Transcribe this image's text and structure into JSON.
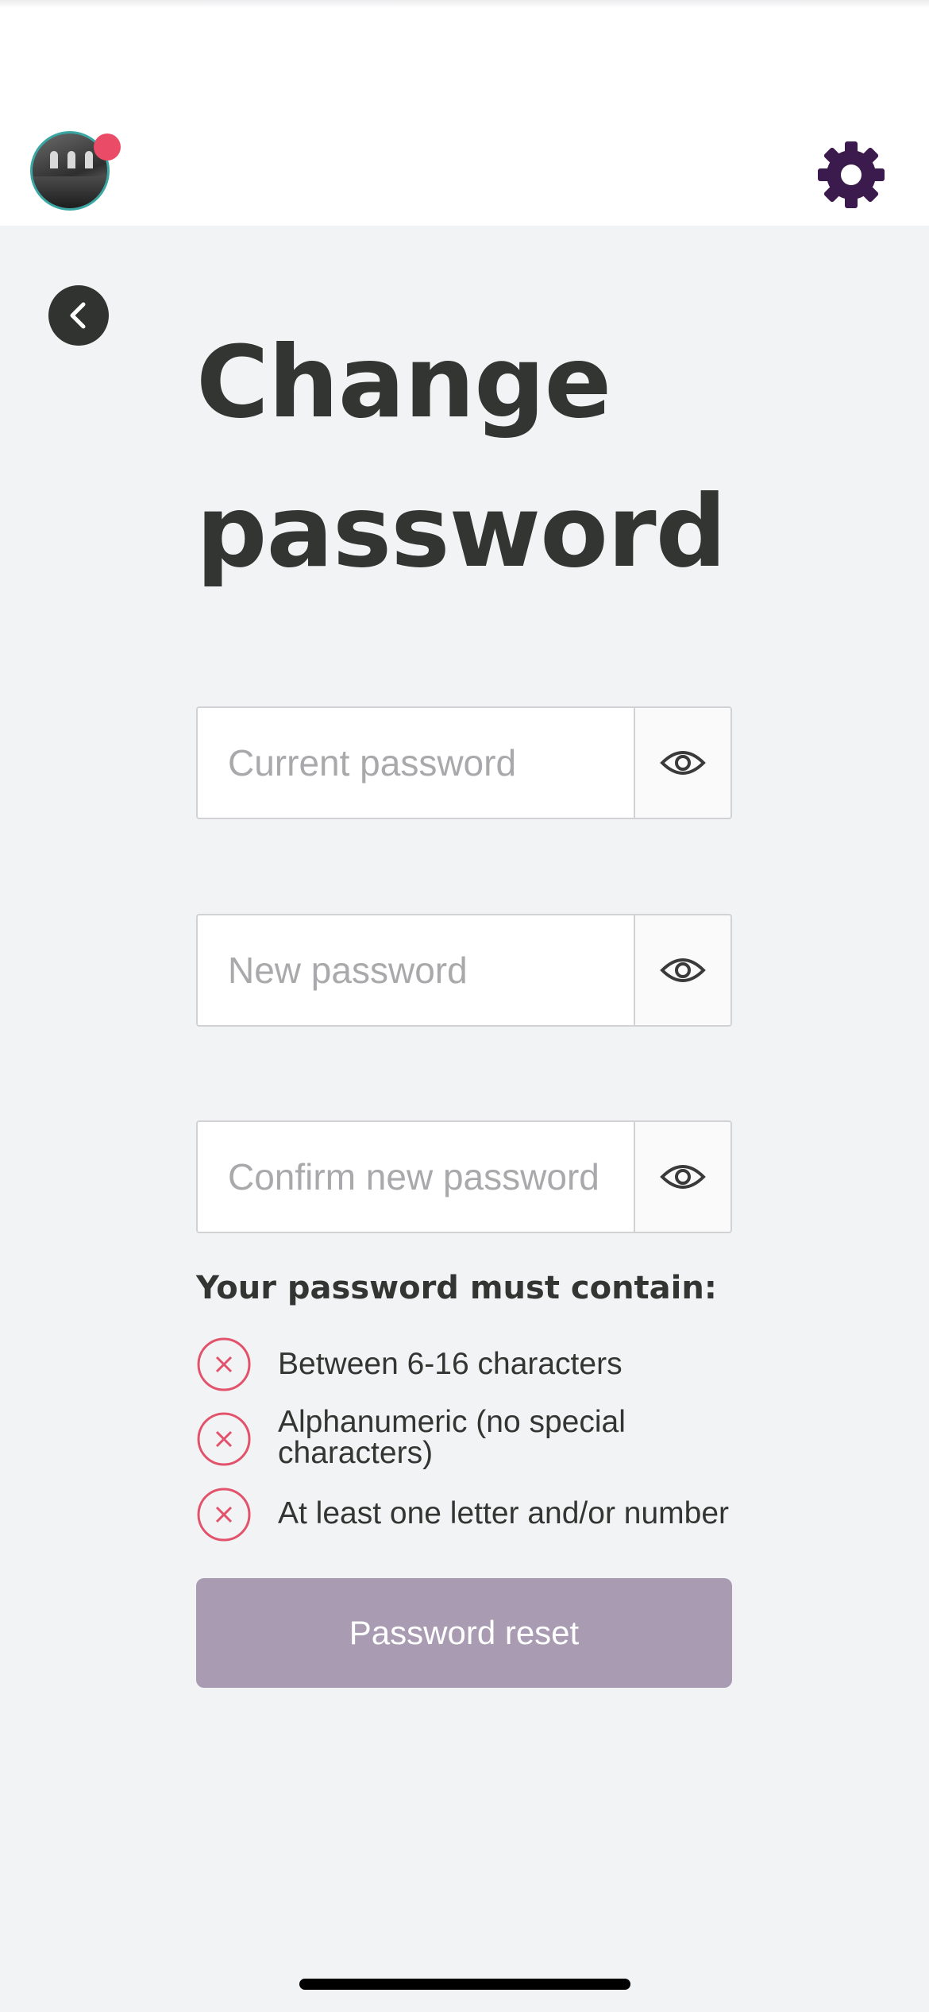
{
  "header": {
    "avatar_icon": "profile-photo",
    "settings_icon": "gear-icon",
    "accent_color": "#3b1a4d",
    "notification_color": "#ea4b66"
  },
  "page": {
    "back_icon": "chevron-left-icon",
    "title_line1": "Change",
    "title_line2": "password"
  },
  "form": {
    "current_password": {
      "placeholder": "Current password",
      "value": ""
    },
    "new_password": {
      "placeholder": "New password",
      "value": ""
    },
    "confirm_password": {
      "placeholder": "Confirm new password",
      "value": ""
    },
    "visibility_icon": "eye-icon"
  },
  "requirements": {
    "title": "Your password must contain:",
    "status_icon": "x-circle-icon",
    "status_color": "#e2536b",
    "items": [
      {
        "label": "Between 6-16 characters",
        "met": false
      },
      {
        "label": "Alphanumeric (no special characters)",
        "met": false
      },
      {
        "label": "At least one letter and/or number",
        "met": false
      }
    ]
  },
  "submit": {
    "label": "Password reset",
    "enabled": false,
    "color": "#a89bb2"
  }
}
